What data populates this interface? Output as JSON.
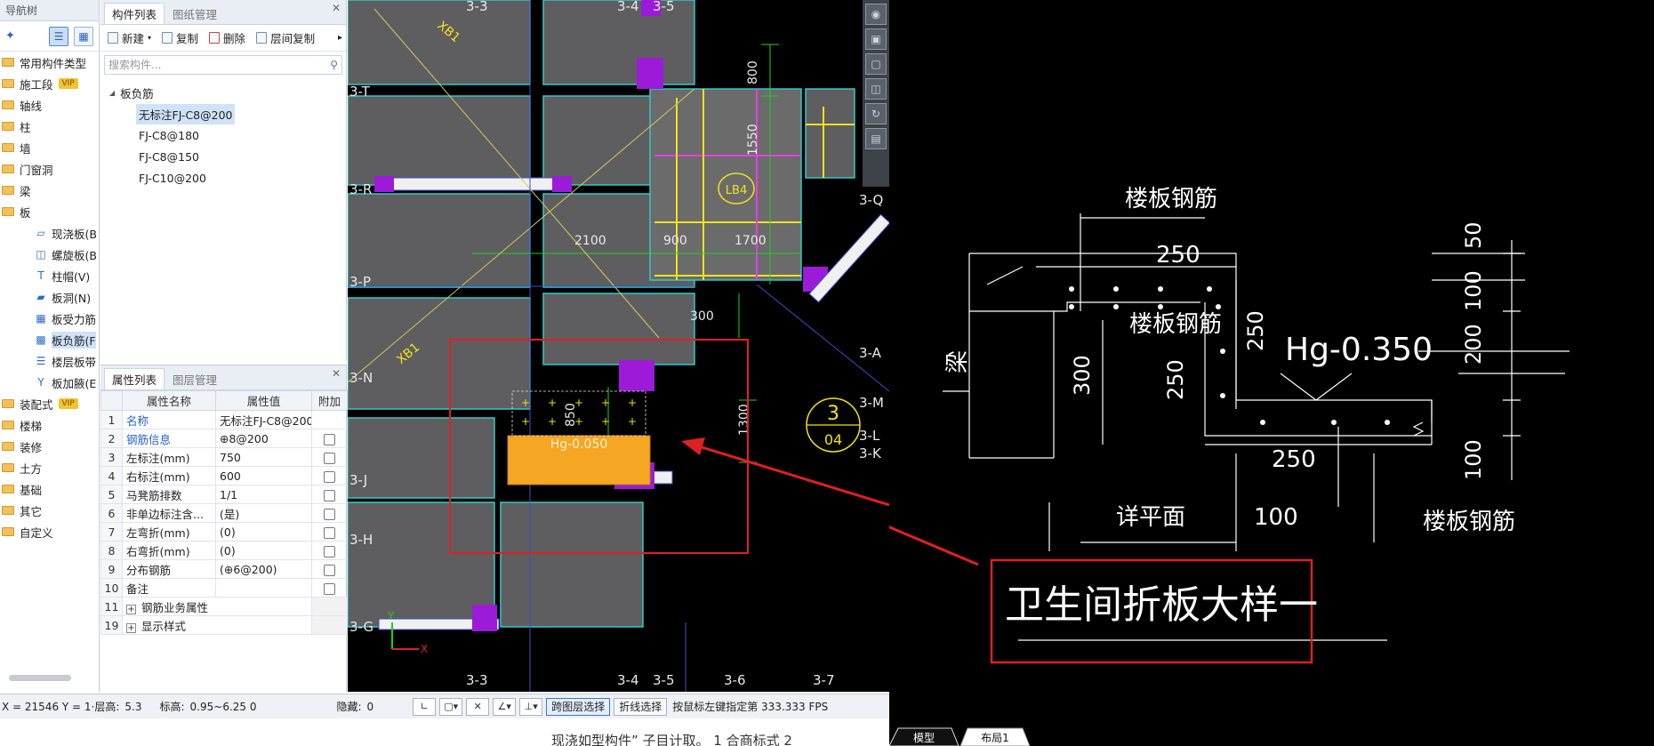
{
  "nav": {
    "title": "导航树",
    "items": [
      {
        "label": "常用构件类型",
        "vip": false
      },
      {
        "label": "施工段",
        "vip": true
      },
      {
        "label": "轴线",
        "vip": false
      },
      {
        "label": "柱",
        "vip": false
      },
      {
        "label": "墙",
        "vip": false
      },
      {
        "label": "门窗洞",
        "vip": false
      },
      {
        "label": "梁",
        "vip": false
      },
      {
        "label": "板",
        "vip": false
      }
    ],
    "subitems": [
      {
        "label": "现浇板(B",
        "icon": "slab-icon"
      },
      {
        "label": "螺旋板(B",
        "icon": "spiral-slab-icon"
      },
      {
        "label": "柱帽(V)",
        "icon": "column-cap-icon"
      },
      {
        "label": "板洞(N)",
        "icon": "slab-hole-icon"
      },
      {
        "label": "板受力筋",
        "icon": "slab-rebar-icon"
      },
      {
        "label": "板负筋(F",
        "icon": "negative-rebar-icon",
        "selected": true
      },
      {
        "label": "楼层板带",
        "icon": "slab-strip-icon"
      },
      {
        "label": "板加腋(E",
        "icon": "slab-haunch-icon"
      }
    ],
    "items2": [
      {
        "label": "装配式",
        "vip": true
      },
      {
        "label": "楼梯",
        "vip": false
      },
      {
        "label": "装修",
        "vip": false
      },
      {
        "label": "土方",
        "vip": false
      },
      {
        "label": "基础",
        "vip": false
      },
      {
        "label": "其它",
        "vip": false
      },
      {
        "label": "自定义",
        "vip": false
      }
    ],
    "vip_label": "VIP"
  },
  "components": {
    "tabs": [
      "构件列表",
      "图纸管理"
    ],
    "toolbar": {
      "new": "新建",
      "copy": "复制",
      "delete": "删除",
      "floor_copy": "层间复制",
      "more": "▸"
    },
    "search_placeholder": "搜索构件...",
    "tree_parent": "板负筋",
    "tree_children": [
      "无标注FJ-C8@200",
      "FJ-C8@180",
      "FJ-C8@150",
      "FJ-C10@200"
    ]
  },
  "properties": {
    "tabs": [
      "属性列表",
      "图层管理"
    ],
    "headers": [
      "属性名称",
      "属性值",
      "附加"
    ],
    "rows": [
      {
        "num": "1",
        "name": "名称",
        "value": "无标注FJ-C8@200",
        "blue": true,
        "cb": false
      },
      {
        "num": "2",
        "name": "钢筋信息",
        "value": "⊕8@200",
        "blue": true,
        "cb": true
      },
      {
        "num": "3",
        "name": "左标注(mm)",
        "value": "750",
        "blue": false,
        "cb": true
      },
      {
        "num": "4",
        "name": "右标注(mm)",
        "value": "600",
        "blue": false,
        "cb": true
      },
      {
        "num": "5",
        "name": "马凳筋排数",
        "value": "1/1",
        "blue": false,
        "cb": true
      },
      {
        "num": "6",
        "name": "非单边标注含...",
        "value": "(是)",
        "blue": false,
        "cb": true
      },
      {
        "num": "7",
        "name": "左弯折(mm)",
        "value": "(0)",
        "blue": false,
        "cb": true
      },
      {
        "num": "8",
        "name": "右弯折(mm)",
        "value": "(0)",
        "blue": false,
        "cb": true
      },
      {
        "num": "9",
        "name": "分布钢筋",
        "value": "(⊕6@200)",
        "blue": false,
        "cb": true
      },
      {
        "num": "10",
        "name": "备注",
        "value": "",
        "blue": false,
        "cb": true
      }
    ],
    "groups": [
      {
        "num": "11",
        "name": "钢筋业务属性"
      },
      {
        "num": "19",
        "name": "显示样式"
      }
    ]
  },
  "status": {
    "coords": "X = 21546 Y = 1·层高:",
    "floor_height": "5.3",
    "elevation_label": "标高:",
    "elevation": "0.95~6.25 0",
    "hidden_label": "隐藏:",
    "hidden": "0",
    "cross_layer": "跨图层选择",
    "polyline_select": "折线选择",
    "hint": "按鼠标左键指定第 333.333 FPS"
  },
  "cad": {
    "axis_labels_top": [
      "3-3",
      "3-4",
      "3-5"
    ],
    "axis_labels_bottom": [
      "3-3",
      "3-4",
      "3-5",
      "3-6",
      "3-7"
    ],
    "axis_labels_left": [
      "3-T",
      "3-R",
      "3-P",
      "3-N",
      "3-J",
      "3-H",
      "3-G"
    ],
    "axis_labels_right": [
      "3-Q",
      "3-A",
      "3-M",
      "3-L",
      "3-K"
    ],
    "dims": [
      "800",
      "1550",
      "2100",
      "900",
      "1700",
      "300",
      "850",
      "1300"
    ],
    "labels": {
      "xb1a": "XB1",
      "xb1b": "XB1",
      "lb4": "LB4",
      "hg": "Hg-0.050",
      "circle_top": "3",
      "circle_bot": "04",
      "axis_x": "X",
      "axis_y": "Y"
    }
  },
  "detail": {
    "title_top": "楼板钢筋",
    "rebar_mid": "楼板钢筋",
    "rebar_right": "楼板钢筋",
    "beam": "梁",
    "dim_250_top": "250",
    "dim_250_mid": "250",
    "dim_250_left": "250",
    "dim_250_bot": "250",
    "dim_300": "300",
    "dim_100_bot": "100",
    "hg": "Hg-0.350",
    "plan_ref": "详平面",
    "dims_right": [
      "50",
      "100",
      "200",
      "100"
    ],
    "caption": "卫生间折板大样一"
  },
  "cad_tabs": [
    "模型",
    "布局1"
  ],
  "bottom_text": "现浇如型构件” 子目计取。 1 合商标式 2",
  "colors": {
    "accent": "#2460c8",
    "highlight": "#f5a623",
    "annotation": "#e02020"
  }
}
